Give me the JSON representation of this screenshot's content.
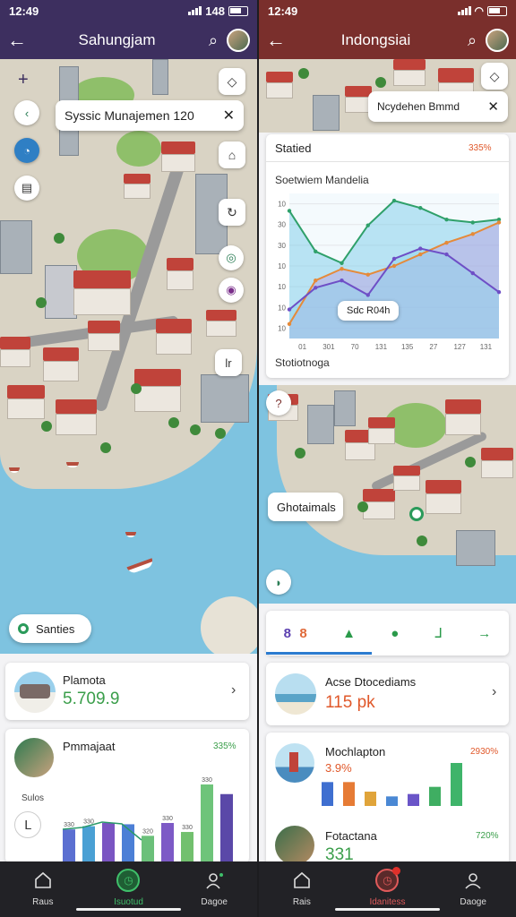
{
  "left": {
    "status_time": "12:49",
    "status_right": "148",
    "title": "Sahungjam",
    "search_card": "Syssic Munajemen 120",
    "pill_label": "Santies",
    "fab_label": "lr",
    "card1": {
      "title": "Plamota",
      "value": "5.709.9"
    },
    "card2": {
      "title": "Pmmajaat",
      "pct": "335%",
      "side_label": "Sulos",
      "bar_labels": [
        "330",
        "330",
        "320",
        "330",
        "330"
      ],
      "bar_top_label": "330",
      "bars": [
        {
          "value": 5.0,
          "color": "#5b6fd1"
        },
        {
          "value": 5.5,
          "color": "#4aa0d4"
        },
        {
          "value": 6.0,
          "color": "#7a55c2"
        },
        {
          "value": 5.8,
          "color": "#4c7fd6"
        },
        {
          "value": 4.0,
          "color": "#6bc07a"
        },
        {
          "value": 6.0,
          "color": "#7d5ac6"
        },
        {
          "value": 4.6,
          "color": "#72c06e"
        },
        {
          "value": 12.0,
          "color": "#6ec47a"
        },
        {
          "value": 10.5,
          "color": "#5a48a8"
        }
      ]
    },
    "nav": [
      {
        "label": "Raus"
      },
      {
        "label": "Isuotud"
      },
      {
        "label": "Dagoe"
      }
    ],
    "colors": {
      "header": "#3d2f5f",
      "accent": "#3a9e4a"
    }
  },
  "right": {
    "status_time": "12:49",
    "title": "Indongsiai",
    "search_card": "Ncydehen Bmmd",
    "chart_card": {
      "title": "Statied",
      "pct": "335%",
      "chart_title": "Soetwiem Mandelia",
      "tooltip": "Sdc R04h",
      "footer": "Stotiotnoga"
    },
    "chart_data": {
      "type": "area",
      "title": "Soetwiem Mandelia",
      "xlabel": "",
      "ylabel": "",
      "x_ticks": [
        "01",
        "301",
        "70",
        "131",
        "135",
        "27",
        "127",
        "131"
      ],
      "y_ticks": [
        "10",
        "30",
        "30",
        "10",
        "10",
        "10",
        "10"
      ],
      "series": [
        {
          "color": "#2fa06a",
          "values": [
            88,
            60,
            52,
            78,
            95,
            90,
            82,
            80,
            82
          ]
        },
        {
          "color": "#e58a3a",
          "values": [
            10,
            40,
            48,
            44,
            50,
            58,
            66,
            72,
            80
          ]
        },
        {
          "color": "#6e4fc6",
          "values": [
            20,
            35,
            40,
            30,
            55,
            62,
            58,
            45,
            32
          ]
        }
      ],
      "fill_colors": [
        "#6fc7e6",
        "#b89be0",
        "#8cd3ec"
      ],
      "ylim": [
        0,
        100
      ]
    },
    "pill_label": "Ghotaimals",
    "tabs": [
      {
        "icon": "8",
        "color": "#5b3fb0"
      },
      {
        "icon": "8",
        "color": "#e06a3a"
      },
      {
        "icon": "▲",
        "color": "#2a9a4a"
      },
      {
        "icon": "●",
        "color": "#2a9a4a"
      },
      {
        "icon": "ᒧ",
        "color": "#2a9a4a"
      },
      {
        "icon": "→",
        "color": "#2a9a4a"
      }
    ],
    "card1": {
      "title": "Acse Dtocediams",
      "value": "115 pk"
    },
    "card2": {
      "title": "Mochlapton",
      "pct": "2930%",
      "value": "3.9%",
      "bars": [
        {
          "value": 5,
          "color": "#3f6fd0"
        },
        {
          "value": 5,
          "color": "#e67b35"
        },
        {
          "value": 3,
          "color": "#e0a43a"
        },
        {
          "value": 2,
          "color": "#4a88d4"
        },
        {
          "value": 2.5,
          "color": "#6a55c8"
        },
        {
          "value": 4,
          "color": "#3fae62"
        },
        {
          "value": 9,
          "color": "#3fb46a"
        }
      ]
    },
    "card3": {
      "title": "Fotactana",
      "pct": "720%",
      "value": "331"
    },
    "nav": [
      {
        "label": "Rais"
      },
      {
        "label": "Idanitess"
      },
      {
        "label": "Daoge"
      }
    ],
    "colors": {
      "header": "#7a2f2c",
      "accent": "#e0582a"
    }
  }
}
